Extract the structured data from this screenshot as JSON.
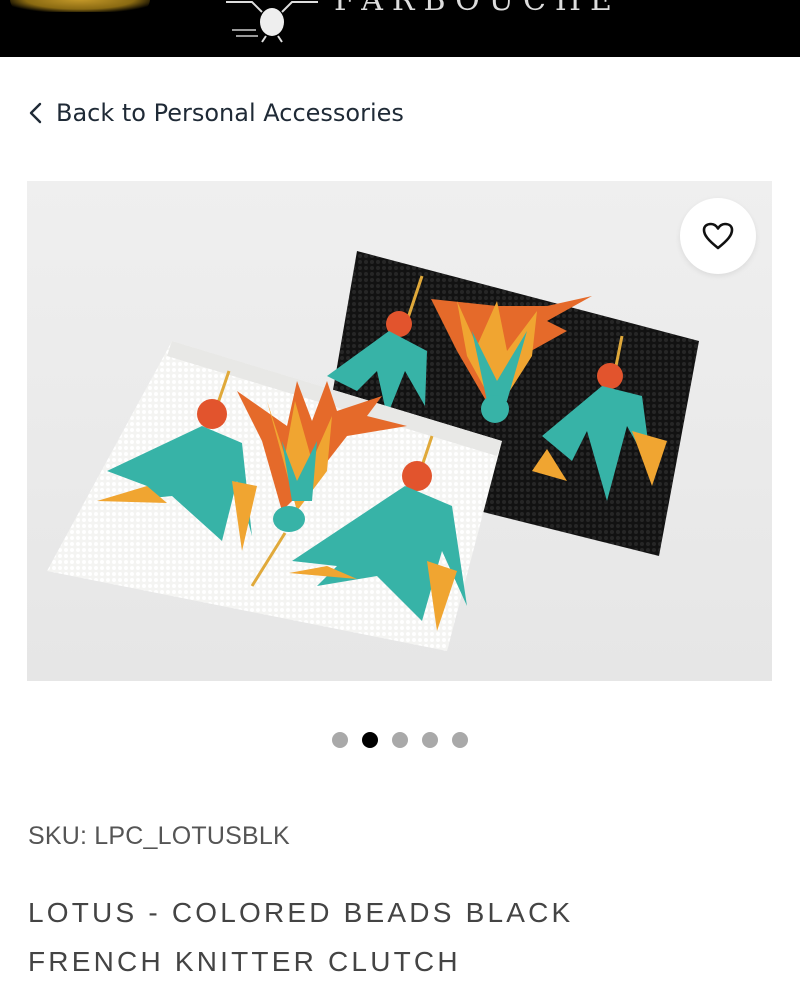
{
  "header": {
    "brand_text": "FARBOUCHE",
    "logo_icon": "bird-logo-icon"
  },
  "nav": {
    "back_label": "Back to Personal Accessories",
    "back_icon": "chevron-left-icon"
  },
  "gallery": {
    "favorite_icon": "heart-icon",
    "image_count": 5,
    "active_index": 1
  },
  "product": {
    "sku": "SKU: LPC_LOTUSBLK",
    "title_line1": "LOTUS - COLORED BEADS BLACK",
    "title_line2": "FRENCH KNITTER CLUTCH"
  },
  "colors": {
    "header_bg": "#000000",
    "dot_active": "#000000",
    "dot_inactive": "#a9a9a9"
  }
}
